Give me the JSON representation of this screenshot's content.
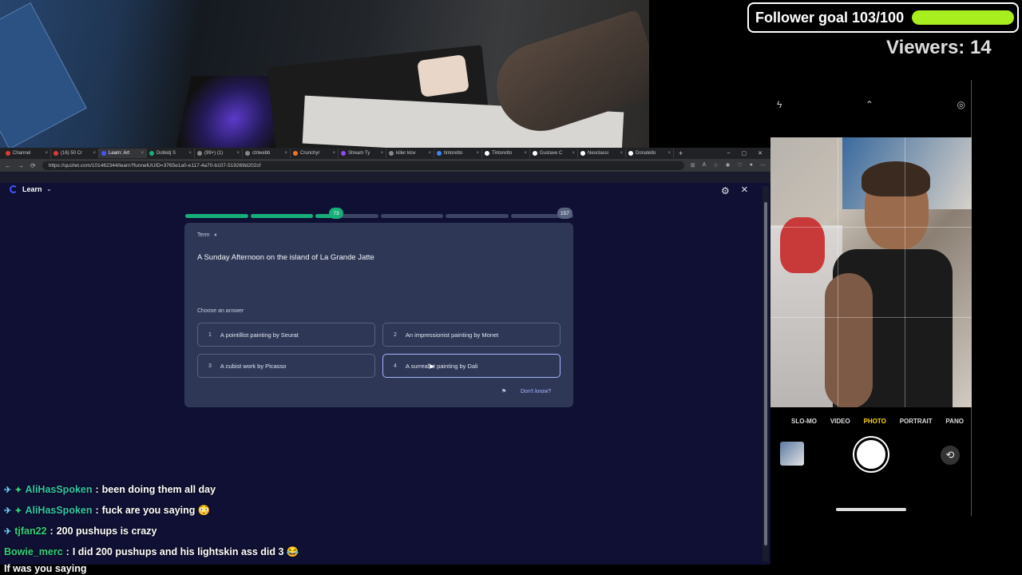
{
  "overlay": {
    "follower_goal_label": "Follower goal 103/100",
    "follower_goal_fraction": 1.0,
    "viewers_label": "Viewers: 14",
    "goal_bar_color": "#a8ee1e"
  },
  "browser": {
    "tabs": [
      {
        "label": "Channel",
        "color": "#e53935"
      },
      {
        "label": "(16) 50 Cr",
        "color": "#e53935"
      },
      {
        "label": "Learn: Art",
        "color": "#4255ff",
        "active": true
      },
      {
        "label": "Dotkidj S",
        "color": "#18ae79"
      },
      {
        "label": "(99+) (1) ",
        "color": "#888"
      },
      {
        "label": "ctrlwebb",
        "color": "#888"
      },
      {
        "label": "Crunchyr",
        "color": "#f47521"
      },
      {
        "label": "Stream Ty",
        "color": "#9146ff"
      },
      {
        "label": "killer klov",
        "color": "#888"
      },
      {
        "label": "tintoretto",
        "color": "#4285f4"
      },
      {
        "label": "Tintoretto",
        "color": "#fff"
      },
      {
        "label": "Gustave C",
        "color": "#fff"
      },
      {
        "label": "Neoclassi",
        "color": "#fff"
      },
      {
        "label": "Donatello",
        "color": "#fff"
      }
    ],
    "url": "https://quizlet.com/101462344/learn?funnelUUID=3765e1a0-e117-4a70-b107-519269d202cf"
  },
  "quiz": {
    "header_title": "Learn",
    "progress_current": "73",
    "progress_total": "157",
    "term_label": "Term",
    "term_text": "A Sunday Afternoon on the island of La Grande Jatte",
    "choose_label": "Choose an answer",
    "options": [
      {
        "num": "1",
        "text": "A pointillist painting by Seurat"
      },
      {
        "num": "2",
        "text": "An impressionist painting by Monet"
      },
      {
        "num": "3",
        "text": "A cubist work by Picasso"
      },
      {
        "num": "4",
        "text": "A surrealist painting by Dali"
      }
    ],
    "dont_know": "Don't know?"
  },
  "chat": [
    {
      "user": "AliHasSpoken",
      "text": "been doing them all day",
      "color": "cyan",
      "badges": true
    },
    {
      "user": "AliHasSpoken",
      "text": "fuck are you saying 😳",
      "color": "cyan",
      "badges": true
    },
    {
      "user": "tjfan22",
      "text": "200 pushups is crazy",
      "color": "green",
      "badges": true
    },
    {
      "user": "Bowie_merc",
      "text": "I did 200 pushups and his lightskin ass did 3 😂",
      "color": "green",
      "badges": false
    },
    {
      "user": "",
      "text": "If was you saying",
      "color": "",
      "badges": false
    }
  ],
  "camera": {
    "modes": [
      "SLO-MO",
      "VIDEO",
      "PHOTO",
      "PORTRAIT",
      "PANO"
    ],
    "selected_mode": "PHOTO"
  }
}
